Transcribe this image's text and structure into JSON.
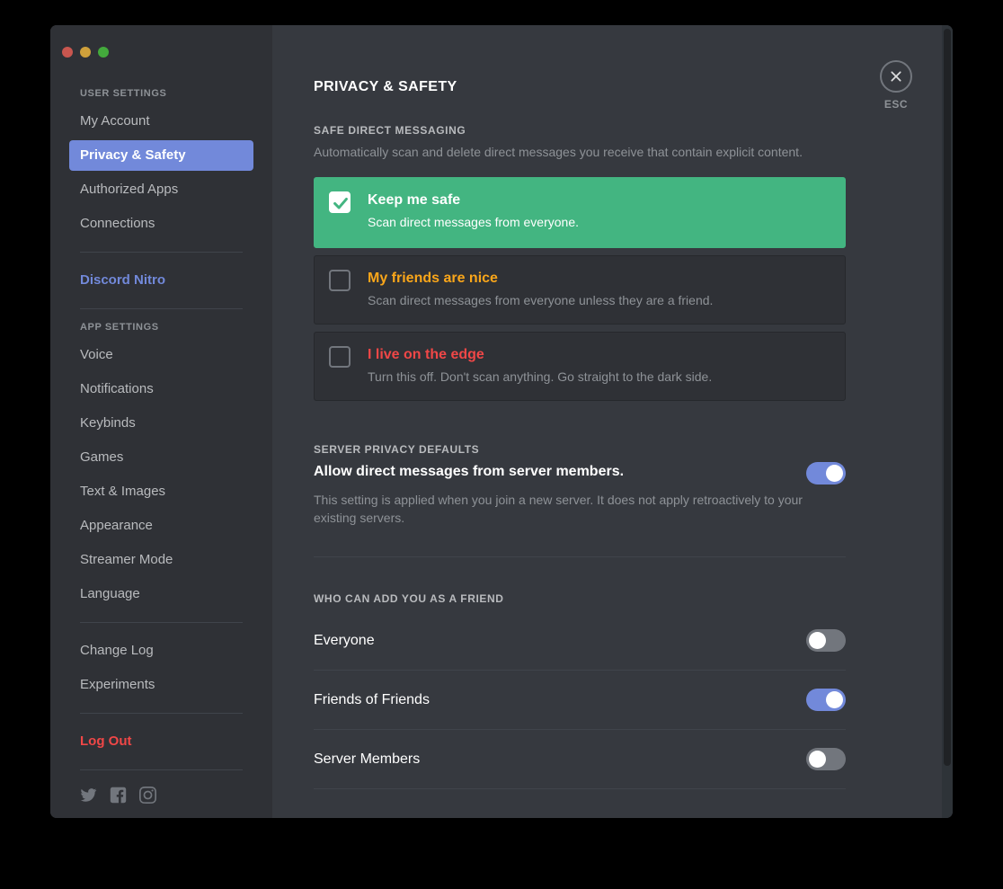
{
  "window": {
    "traffic_lights": [
      "close",
      "minimize",
      "maximize"
    ]
  },
  "sidebar": {
    "user_settings_header": "USER SETTINGS",
    "user_items": [
      {
        "label": "My Account",
        "selected": false
      },
      {
        "label": "Privacy & Safety",
        "selected": true
      },
      {
        "label": "Authorized Apps",
        "selected": false
      },
      {
        "label": "Connections",
        "selected": false
      }
    ],
    "nitro_label": "Discord Nitro",
    "app_settings_header": "APP SETTINGS",
    "app_items": [
      {
        "label": "Voice"
      },
      {
        "label": "Notifications"
      },
      {
        "label": "Keybinds"
      },
      {
        "label": "Games"
      },
      {
        "label": "Text & Images"
      },
      {
        "label": "Appearance"
      },
      {
        "label": "Streamer Mode"
      },
      {
        "label": "Language"
      }
    ],
    "misc_items": [
      {
        "label": "Change Log"
      },
      {
        "label": "Experiments"
      }
    ],
    "logout_label": "Log Out",
    "social_icons": [
      "twitter-icon",
      "facebook-icon",
      "instagram-icon"
    ]
  },
  "main": {
    "page_title": "PRIVACY & SAFETY",
    "safe_dm": {
      "header": "SAFE DIRECT MESSAGING",
      "description": "Automatically scan and delete direct messages you receive that contain explicit content.",
      "options": [
        {
          "title": "Keep me safe",
          "subtitle": "Scan direct messages from everyone.",
          "checked": true,
          "style": "active"
        },
        {
          "title": "My friends are nice",
          "subtitle": "Scan direct messages from everyone unless they are a friend.",
          "checked": false,
          "style": "warn"
        },
        {
          "title": "I live on the edge",
          "subtitle": "Turn this off. Don't scan anything. Go straight to the dark side.",
          "checked": false,
          "style": "crit"
        }
      ]
    },
    "server_privacy": {
      "header": "SERVER PRIVACY DEFAULTS",
      "label": "Allow direct messages from server members.",
      "note": "This setting is applied when you join a new server. It does not apply retroactively to your existing servers.",
      "enabled": true
    },
    "friend_access": {
      "header": "WHO CAN ADD YOU AS A FRIEND",
      "rows": [
        {
          "label": "Everyone",
          "enabled": false
        },
        {
          "label": "Friends of Friends",
          "enabled": true
        },
        {
          "label": "Server Members",
          "enabled": false
        }
      ]
    },
    "close": {
      "label": "ESC",
      "icon": "close-icon"
    }
  },
  "colors": {
    "accent_blurple": "#7289da",
    "success_green": "#43b581",
    "warning_orange": "#faa61a",
    "danger_red": "#f04747",
    "sidebar_bg": "#2f3136",
    "content_bg": "#36393f"
  }
}
